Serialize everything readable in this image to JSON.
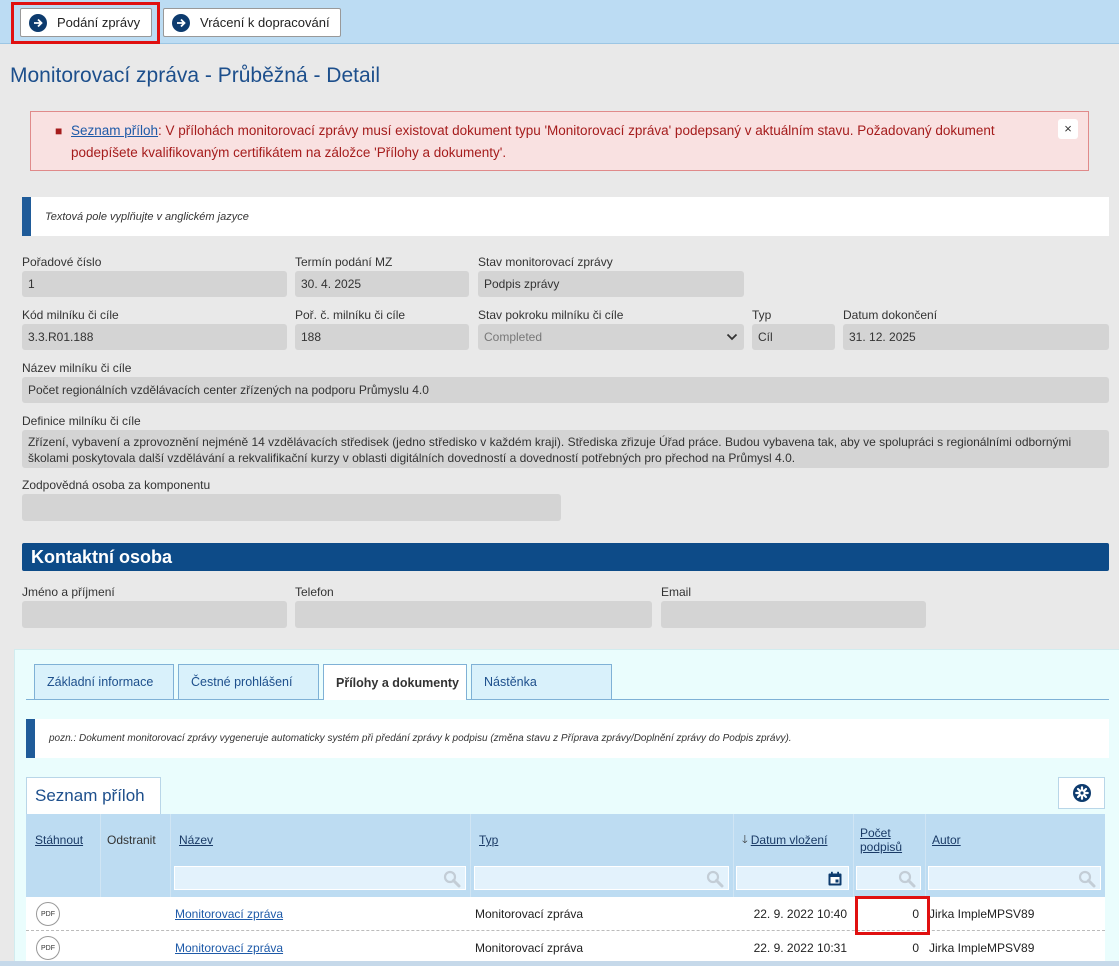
{
  "toolbar": {
    "submit_label": "Podání zprávy",
    "return_label": "Vrácení k dopracování"
  },
  "page_title": "Monitorovací zpráva - Průběžná - Detail",
  "alert": {
    "link_text": "Seznam příloh",
    "message": ": V přílohách monitorovací zprávy musí existovat dokument typu 'Monitorovací zpráva' podepsaný v aktuálním stavu. Požadovaný dokument podepíšete kvalifikovaným certifikátem na záložce 'Přílohy a dokumenty'.",
    "close_label": "×"
  },
  "note_language": "Textová pole vyplňujte v anglickém jazyce",
  "form": {
    "poradove_cislo": {
      "label": "Pořadové číslo",
      "value": "1"
    },
    "termin_podani": {
      "label": "Termín podání MZ",
      "value": "30. 4. 2025"
    },
    "stav_zpravy": {
      "label": "Stav monitorovací zprávy",
      "value": "Podpis zprávy"
    },
    "kod_milniku": {
      "label": "Kód milníku či cíle",
      "value": "3.3.R01.188"
    },
    "por_milniku": {
      "label": "Poř. č. milníku či cíle",
      "value": "188"
    },
    "stav_pokroku": {
      "label": "Stav pokroku milníku či cíle",
      "value": "Completed"
    },
    "typ": {
      "label": "Typ",
      "value": "Cíl"
    },
    "datum_dokonceni": {
      "label": "Datum dokončení",
      "value": "31. 12. 2025"
    },
    "nazev": {
      "label": "Název milníku či cíle",
      "value": "Počet regionálních vzdělávacích center zřízených na podporu Průmyslu 4.0"
    },
    "definice": {
      "label": "Definice milníku či cíle",
      "value": "Zřízení, vybavení a zprovoznění nejméně 14 vzdělávacích středisek (jedno středisko v každém kraji). Střediska zřizuje Úřad práce. Budou vybavena tak, aby ve spolupráci s regionálními odbornými školami poskytovala další vzdělávání a rekvalifikační kurzy v oblasti digitálních dovedností a dovedností potřebných pro přechod na Průmysl 4.0."
    },
    "zodpovedna_osoba": {
      "label": "Zodpovědná osoba za komponentu",
      "value": ""
    }
  },
  "contact": {
    "section_title": "Kontaktní osoba",
    "name_label": "Jméno a příjmení",
    "phone_label": "Telefon",
    "email_label": "Email"
  },
  "tabs": [
    {
      "label": "Základní informace"
    },
    {
      "label": "Čestné prohlášení"
    },
    {
      "label": "Přílohy a dokumenty"
    },
    {
      "label": "Nástěnka"
    }
  ],
  "note_document": "pozn.: Dokument monitorovací zprávy vygeneruje automaticky systém při předání zprávy k podpisu (změna stavu z Příprava zprávy/Doplnění zprávy do Podpis zprávy).",
  "attachments": {
    "title": "Seznam příloh",
    "columns": {
      "download": "Stáhnout",
      "remove": "Odstranit",
      "name": "Název",
      "type": "Typ",
      "date": "Datum vložení",
      "sort_arrow": "🡓",
      "signatures_1": "Počet",
      "signatures_2": "podpisů",
      "author": "Autor"
    },
    "pdf_label": "PDF",
    "rows": [
      {
        "name": "Monitorovací zpráva",
        "type": "Monitorovací zpráva",
        "date": "22. 9. 2022 10:40",
        "signatures": "0",
        "author": "Jirka ImpleMPSV89"
      },
      {
        "name": "Monitorovací zpráva",
        "type": "Monitorovací zpráva",
        "date": "22. 9. 2022 10:31",
        "signatures": "0",
        "author": "Jirka ImpleMPSV89"
      }
    ]
  }
}
